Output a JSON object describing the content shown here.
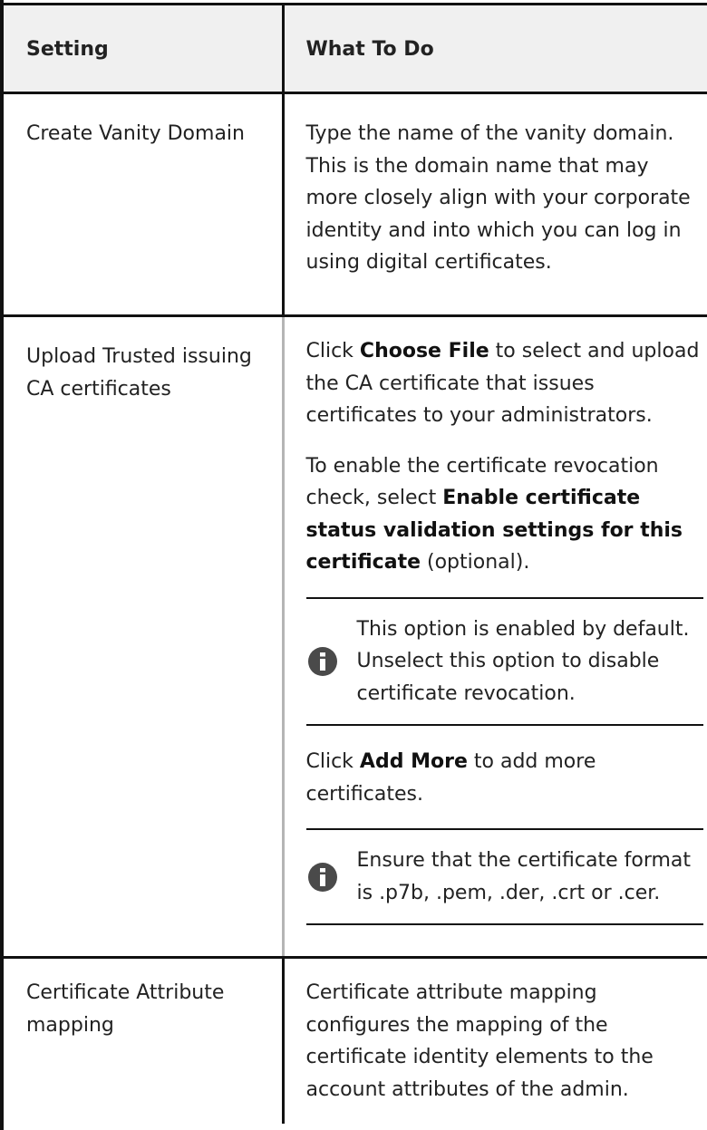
{
  "table": {
    "headers": [
      "Setting",
      "What To Do"
    ],
    "rows": [
      {
        "setting": "Create Vanity Domain",
        "paragraphs": [
          {
            "text": "Type the name of the vanity domain. This is the domain name that may more closely align with your corporate identity and into which you can log in using digital certificates."
          }
        ]
      },
      {
        "setting": "Upload Trusted issuing CA certificates",
        "p1": {
          "pre": "Click ",
          "bold": "Choose File",
          "post": " to select and upload the CA certificate that issues certificates to your administrators."
        },
        "p2": {
          "pre": "To enable the certificate revocation check, select ",
          "bold": "Enable certificate status validation settings for this certificate",
          "post": " (optional)."
        },
        "note1": {
          "icon": "info-icon",
          "text": "This option is enabled by default. Unselect this option to disable certificate revocation."
        },
        "p3": {
          "pre": "Click ",
          "bold": "Add More",
          "post": " to add more certificates."
        },
        "note2": {
          "icon": "info-icon",
          "text": "Ensure that the certificate format is .p7b, .pem, .der, .crt or .cer."
        }
      },
      {
        "setting": "Certificate Attribute mapping",
        "paragraphs": [
          {
            "text": "Certificate attribute mapping configures the mapping of the certificate identity elements to the account attributes of the admin."
          }
        ]
      }
    ]
  }
}
